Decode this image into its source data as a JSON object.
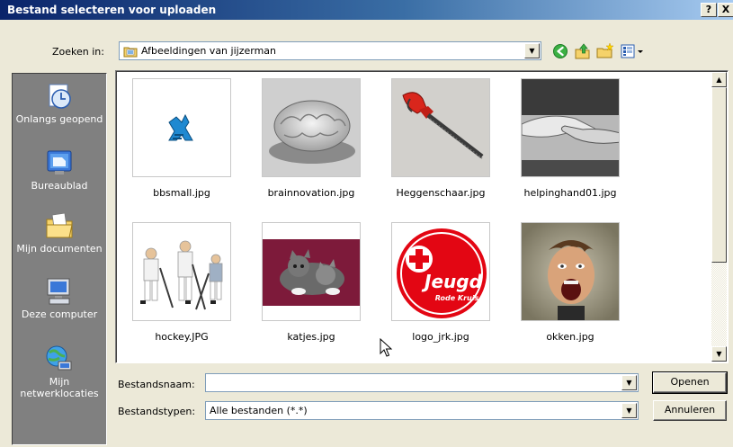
{
  "window": {
    "title": "Bestand selecteren voor uploaden",
    "help_label": "?",
    "close_label": "X"
  },
  "lookin": {
    "label": "Zoeken in:",
    "value": "Afbeeldingen van jijzerman"
  },
  "toolbar": {
    "back_icon": "back-arrow-icon",
    "up_icon": "up-folder-icon",
    "new_folder_icon": "new-folder-icon",
    "views_icon": "views-menu-icon"
  },
  "places": [
    {
      "label": "Onlangs geopend",
      "icon": "recent-icon"
    },
    {
      "label": "Bureaublad",
      "icon": "desktop-icon"
    },
    {
      "label": "Mijn documenten",
      "icon": "my-documents-icon"
    },
    {
      "label": "Deze computer",
      "icon": "my-computer-icon"
    },
    {
      "label": "Mijn netwerklocaties",
      "icon": "network-places-icon"
    }
  ],
  "files": [
    {
      "name": "bbsmall.jpg"
    },
    {
      "name": "brainnovation.jpg"
    },
    {
      "name": "Heggenschaar.jpg"
    },
    {
      "name": "helpinghand01.jpg"
    },
    {
      "name": "hockey.JPG"
    },
    {
      "name": "katjes.jpg"
    },
    {
      "name": "logo_jrk.jpg",
      "logo_text": "Jeugd",
      "logo_subtext": "Rode Kruis"
    },
    {
      "name": "okken.jpg"
    }
  ],
  "filename": {
    "label": "Bestandsnaam:",
    "value": ""
  },
  "filetype": {
    "label": "Bestandstypen:",
    "value": "Alle bestanden (*.*)"
  },
  "buttons": {
    "open": "Openen",
    "cancel": "Annuleren"
  },
  "colors": {
    "titlebar_start": "#0a246a",
    "titlebar_end": "#a6caf0",
    "places_bg": "#808080",
    "dialog_bg": "#ece9d8",
    "red_cross": "#e30613"
  }
}
